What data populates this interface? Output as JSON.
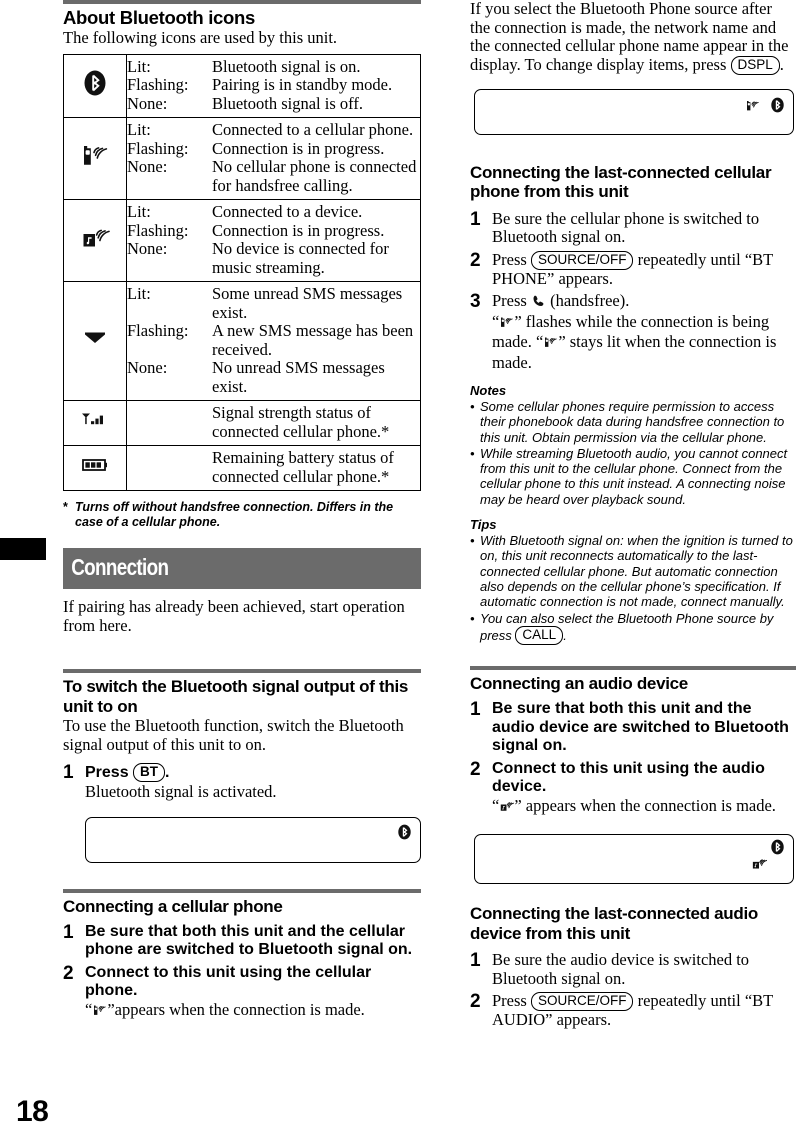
{
  "page_number": "18",
  "left": {
    "heading": "About Bluetooth icons",
    "intro": "The following icons are used by this unit.",
    "table_rows": [
      {
        "icon": "bluetooth-icon",
        "items": [
          {
            "key": "Lit:",
            "value": "Bluetooth signal is on."
          },
          {
            "key": "Flashing:",
            "value": "Pairing is in standby mode."
          },
          {
            "key": "None:",
            "value": "Bluetooth signal is off."
          }
        ]
      },
      {
        "icon": "cellular-phone-signal-icon",
        "items": [
          {
            "key": "Lit:",
            "value": "Connected to a cellular phone."
          },
          {
            "key": "Flashing:",
            "value": "Connection is in progress."
          },
          {
            "key": "None:",
            "value": "No cellular phone is connected for handsfree calling."
          }
        ]
      },
      {
        "icon": "audio-device-signal-icon",
        "items": [
          {
            "key": "Lit:",
            "value": "Connected to a device."
          },
          {
            "key": "Flashing:",
            "value": "Connection is in progress."
          },
          {
            "key": "None:",
            "value": "No device is connected for music streaming."
          }
        ]
      },
      {
        "icon": "envelope-sms-icon",
        "items": [
          {
            "key": "Lit:",
            "value": "Some unread SMS messages exist."
          },
          {
            "key": "Flashing:",
            "value": "A new SMS message has been received."
          },
          {
            "key": "None:",
            "value": "No unread SMS messages exist."
          }
        ]
      },
      {
        "icon": "signal-strength-icon",
        "items": [
          {
            "key": "",
            "value": "Signal strength status of connected cellular phone.*"
          }
        ]
      },
      {
        "icon": "battery-icon",
        "items": [
          {
            "key": "",
            "value": "Remaining battery status of connected cellular phone.*"
          }
        ]
      }
    ],
    "footnote_marker": "*",
    "footnote": "Turns off without handsfree connection. Differs in the case of a cellular phone.",
    "banner": "Connection",
    "banner_body": "If pairing has already been achieved, start operation from here.",
    "section_switch": {
      "heading": "To switch the Bluetooth signal output of this unit to on",
      "body": "To use the Bluetooth function, switch the Bluetooth signal output of this unit to on.",
      "step1_number": "1",
      "step1_press": "Press",
      "step1_key": "BT",
      "step1_period": ".",
      "step1_detail": "Bluetooth signal is activated.",
      "display_icons": [
        "bluetooth-icon"
      ]
    },
    "section_connect_phone": {
      "heading": "Connecting a cellular phone",
      "steps": [
        {
          "number": "1",
          "bold": "Be sure that both this unit and the cellular phone are switched to Bluetooth signal on.",
          "detail": ""
        },
        {
          "number": "2",
          "bold": "Connect to this unit using the cellular phone.",
          "detail_prefix": "“",
          "detail_icon": "cellular-phone-signal-icon",
          "detail_suffix": "”appears when the connection is made."
        }
      ]
    }
  },
  "right": {
    "intro_paragraph_part1": "If you select the Bluetooth Phone source after the connection is made, the network name and the connected cellular phone name appear in the display. To change display items, press",
    "intro_key": "DSPL",
    "intro_paragraph_part2": ".",
    "intro_display_icons": [
      "cellular-phone-signal-icon",
      "bluetooth-icon"
    ],
    "section_last_phone": {
      "heading": "Connecting the last-connected cellular phone from this unit",
      "steps": [
        {
          "number": "1",
          "text": "Be sure the cellular phone is switched to Bluetooth signal on."
        },
        {
          "number": "2",
          "press": "Press",
          "key": "SOURCE/OFF",
          "rest": "repeatedly until “BT PHONE” appears."
        },
        {
          "number": "3",
          "press": "Press",
          "key_icon": "handset-icon",
          "rest": "(handsfree).",
          "detail_a": "“",
          "detail_icon1": "cellular-phone-signal-icon",
          "detail_b": "” flashes while the connection is being made. “",
          "detail_icon2": "cellular-phone-signal-icon",
          "detail_c": "” stays lit when the connection is made."
        }
      ]
    },
    "notes_heading": "Notes",
    "notes": [
      "Some cellular phones require permission to access their phonebook data during handsfree connection to this unit. Obtain permission via the cellular phone.",
      "While streaming Bluetooth audio, you cannot connect from this unit to the cellular phone. Connect from the cellular phone to this unit instead. A connecting noise may be heard over playback sound."
    ],
    "tips_heading": "Tips",
    "tips": [
      {
        "text": "With Bluetooth signal on: when the ignition is turned to on, this unit reconnects automatically to the last-connected cellular phone. But automatic connection also depends on the cellular phone’s specification. If automatic connection is not made, connect manually."
      },
      {
        "text_before": "You can also select the Bluetooth Phone source by press",
        "key": "CALL",
        "text_after": "."
      }
    ],
    "section_audio_device": {
      "heading": "Connecting an audio device",
      "steps": [
        {
          "number": "1",
          "bold": "Be sure that both this unit and the audio device are switched to Bluetooth signal on."
        },
        {
          "number": "2",
          "bold": "Connect to this unit using the audio device.",
          "detail_prefix": "“",
          "detail_icon": "audio-device-signal-icon",
          "detail_suffix": "” appears when the connection is made."
        }
      ],
      "display_icons": [
        "bluetooth-icon",
        "audio-device-signal-icon"
      ]
    },
    "section_last_audio": {
      "heading": "Connecting the last-connected audio device from this unit",
      "steps": [
        {
          "number": "1",
          "text": "Be sure the audio device is switched to Bluetooth signal on."
        },
        {
          "number": "2",
          "press": "Press",
          "key": "SOURCE/OFF",
          "rest": "repeatedly until “BT AUDIO” appears."
        }
      ]
    }
  }
}
